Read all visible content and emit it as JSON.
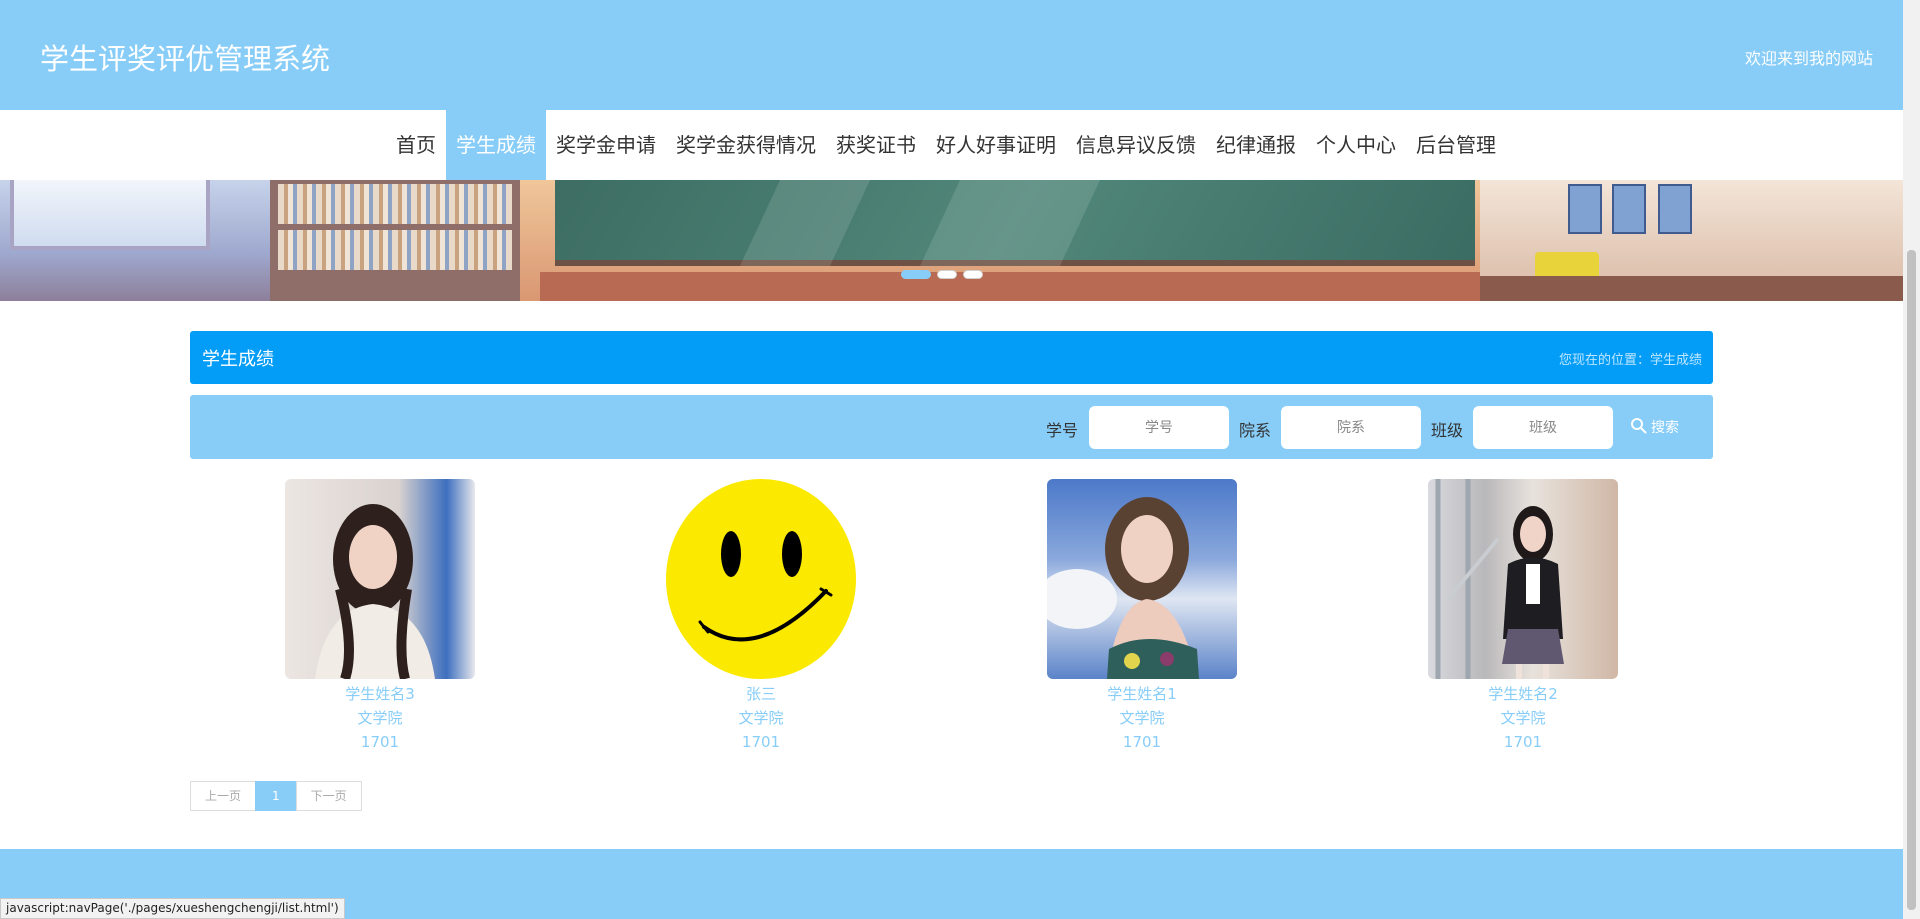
{
  "header": {
    "site_title": "学生评奖评优管理系统",
    "welcome": "欢迎来到我的网站"
  },
  "nav": {
    "items": [
      {
        "label": "首页",
        "active": false
      },
      {
        "label": "学生成绩",
        "active": true
      },
      {
        "label": "奖学金申请",
        "active": false
      },
      {
        "label": "奖学金获得情况",
        "active": false
      },
      {
        "label": "获奖证书",
        "active": false
      },
      {
        "label": "好人好事证明",
        "active": false
      },
      {
        "label": "信息异议反馈",
        "active": false
      },
      {
        "label": "纪律通报",
        "active": false
      },
      {
        "label": "个人中心",
        "active": false
      },
      {
        "label": "后台管理",
        "active": false
      }
    ]
  },
  "banner": {
    "slide_count": 3,
    "active_slide": 1
  },
  "section": {
    "title": "学生成绩",
    "breadcrumb": "您现在的位置：学生成绩"
  },
  "search": {
    "fields": [
      {
        "label": "学号",
        "placeholder": "学号",
        "value": ""
      },
      {
        "label": "院系",
        "placeholder": "院系",
        "value": ""
      },
      {
        "label": "班级",
        "placeholder": "班级",
        "value": ""
      }
    ],
    "button_label": "搜索",
    "button_icon": "search-icon"
  },
  "students": [
    {
      "name": "学生姓名3",
      "department": "文学院",
      "class": "1701",
      "photo": "portrait-photo-beige-coat"
    },
    {
      "name": "张三",
      "department": "文学院",
      "class": "1701",
      "photo": "smiley-face-image"
    },
    {
      "name": "学生姓名1",
      "department": "文学院",
      "class": "1701",
      "photo": "portrait-photo-sky"
    },
    {
      "name": "学生姓名2",
      "department": "文学院",
      "class": "1701",
      "photo": "portrait-photo-stairs"
    }
  ],
  "pagination": {
    "prev_label": "上一页",
    "current_page": "1",
    "next_label": "下一页"
  },
  "statusbar": {
    "text": "javascript:navPage('./pages/xueshengchengji/list.html')"
  },
  "colors": {
    "primary_light": "#87cdf8",
    "primary": "#039df8"
  }
}
